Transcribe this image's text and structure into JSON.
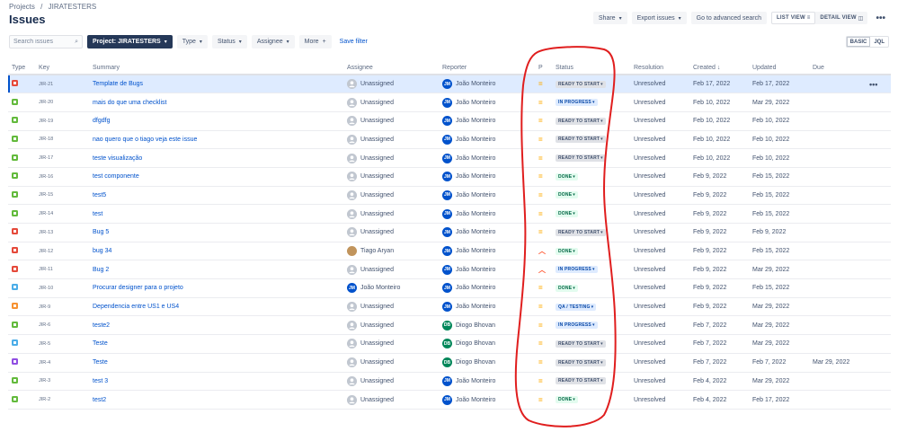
{
  "breadcrumb": [
    "Projects",
    "/",
    "JIRATESTERS"
  ],
  "page_title": "Issues",
  "toolbar": {
    "share": "Share",
    "export": "Export issues",
    "advanced": "Go to advanced search",
    "list_view": "LIST VIEW",
    "detail_view": "DETAIL VIEW",
    "more": "•••"
  },
  "filters": {
    "search_placeholder": "Search issues",
    "project": "Project: JIRATESTERS",
    "type": "Type",
    "status": "Status",
    "assignee": "Assignee",
    "more": "More",
    "save": "Save filter"
  },
  "mode": {
    "basic": "BASIC",
    "jql": "JQL"
  },
  "columns": [
    "Type",
    "Key",
    "Summary",
    "Assignee",
    "Reporter",
    "P",
    "Status",
    "Resolution",
    "Created",
    "Updated",
    "Due"
  ],
  "colors": {
    "bug": "#e5493a",
    "story": "#63ba3c",
    "task": "#4bade8",
    "subtask": "#4bade8",
    "epic": "#904ee2",
    "improvement": "#f79232",
    "medium_priority": "#ffab00",
    "high_priority": "#ff5630",
    "annotation": "#e01e1e"
  },
  "rows": [
    {
      "type": "bug",
      "key": "JIR-21",
      "summary": "Template de Bugs",
      "assignee": "Unassigned",
      "assignee_avatar": "unassigned",
      "reporter": "João Monteiro",
      "reporter_avatar": "JM",
      "priority": "medium",
      "status": "READY TO START",
      "status_kind": "todo",
      "resolution": "Unresolved",
      "created": "Feb 17, 2022",
      "updated": "Feb 17, 2022",
      "due": "",
      "selected": true
    },
    {
      "type": "story",
      "key": "JIR-20",
      "summary": "mais do que uma checklist",
      "assignee": "Unassigned",
      "assignee_avatar": "unassigned",
      "reporter": "João Monteiro",
      "reporter_avatar": "JM",
      "priority": "medium",
      "status": "IN PROGRESS",
      "status_kind": "progress",
      "resolution": "Unresolved",
      "created": "Feb 10, 2022",
      "updated": "Mar 29, 2022",
      "due": ""
    },
    {
      "type": "story",
      "key": "JIR-19",
      "summary": "dfgdfg",
      "assignee": "Unassigned",
      "assignee_avatar": "unassigned",
      "reporter": "João Monteiro",
      "reporter_avatar": "JM",
      "priority": "medium",
      "status": "READY TO START",
      "status_kind": "todo",
      "resolution": "Unresolved",
      "created": "Feb 10, 2022",
      "updated": "Feb 10, 2022",
      "due": ""
    },
    {
      "type": "story",
      "key": "JIR-18",
      "summary": "nao quero que o tiago veja este issue",
      "assignee": "Unassigned",
      "assignee_avatar": "unassigned",
      "reporter": "João Monteiro",
      "reporter_avatar": "JM",
      "priority": "medium",
      "status": "READY TO START",
      "status_kind": "todo",
      "resolution": "Unresolved",
      "created": "Feb 10, 2022",
      "updated": "Feb 10, 2022",
      "due": ""
    },
    {
      "type": "story",
      "key": "JIR-17",
      "summary": "teste visualização",
      "assignee": "Unassigned",
      "assignee_avatar": "unassigned",
      "reporter": "João Monteiro",
      "reporter_avatar": "JM",
      "priority": "medium",
      "status": "READY TO START",
      "status_kind": "todo",
      "resolution": "Unresolved",
      "created": "Feb 10, 2022",
      "updated": "Feb 10, 2022",
      "due": ""
    },
    {
      "type": "story",
      "key": "JIR-16",
      "summary": "test componente",
      "assignee": "Unassigned",
      "assignee_avatar": "unassigned",
      "reporter": "João Monteiro",
      "reporter_avatar": "JM",
      "priority": "medium",
      "status": "DONE",
      "status_kind": "done",
      "resolution": "Unresolved",
      "created": "Feb 9, 2022",
      "updated": "Feb 15, 2022",
      "due": ""
    },
    {
      "type": "story",
      "key": "JIR-15",
      "summary": "test5",
      "assignee": "Unassigned",
      "assignee_avatar": "unassigned",
      "reporter": "João Monteiro",
      "reporter_avatar": "JM",
      "priority": "medium",
      "status": "DONE",
      "status_kind": "done",
      "resolution": "Unresolved",
      "created": "Feb 9, 2022",
      "updated": "Feb 15, 2022",
      "due": ""
    },
    {
      "type": "story",
      "key": "JIR-14",
      "summary": "test",
      "assignee": "Unassigned",
      "assignee_avatar": "unassigned",
      "reporter": "João Monteiro",
      "reporter_avatar": "JM",
      "priority": "medium",
      "status": "DONE",
      "status_kind": "done",
      "resolution": "Unresolved",
      "created": "Feb 9, 2022",
      "updated": "Feb 15, 2022",
      "due": ""
    },
    {
      "type": "bug",
      "key": "JIR-13",
      "summary": "Bug 5",
      "assignee": "Unassigned",
      "assignee_avatar": "unassigned",
      "reporter": "João Monteiro",
      "reporter_avatar": "JM",
      "priority": "medium",
      "status": "READY TO START",
      "status_kind": "todo",
      "resolution": "Unresolved",
      "created": "Feb 9, 2022",
      "updated": "Feb 9, 2022",
      "due": ""
    },
    {
      "type": "bug",
      "key": "JIR-12",
      "summary": "bug 34",
      "assignee": "Tiago Aryan",
      "assignee_avatar": "TA",
      "reporter": "João Monteiro",
      "reporter_avatar": "JM",
      "priority": "high",
      "status": "DONE",
      "status_kind": "done",
      "resolution": "Unresolved",
      "created": "Feb 9, 2022",
      "updated": "Feb 15, 2022",
      "due": ""
    },
    {
      "type": "bug",
      "key": "JIR-11",
      "summary": "Bug 2",
      "assignee": "Unassigned",
      "assignee_avatar": "unassigned",
      "reporter": "João Monteiro",
      "reporter_avatar": "JM",
      "priority": "high",
      "status": "IN PROGRESS",
      "status_kind": "progress",
      "resolution": "Unresolved",
      "created": "Feb 9, 2022",
      "updated": "Mar 29, 2022",
      "due": ""
    },
    {
      "type": "task",
      "key": "JIR-10",
      "summary": "Procurar designer para o projeto",
      "assignee": "João Monteiro",
      "assignee_avatar": "JM",
      "reporter": "João Monteiro",
      "reporter_avatar": "JM",
      "priority": "medium",
      "status": "DONE",
      "status_kind": "done",
      "resolution": "Unresolved",
      "created": "Feb 9, 2022",
      "updated": "Feb 15, 2022",
      "due": ""
    },
    {
      "type": "improvement",
      "key": "JIR-9",
      "summary": "Dependencia entre US1 e US4",
      "assignee": "Unassigned",
      "assignee_avatar": "unassigned",
      "reporter": "João Monteiro",
      "reporter_avatar": "JM",
      "priority": "medium",
      "status": "QA / TESTING",
      "status_kind": "qa",
      "resolution": "Unresolved",
      "created": "Feb 9, 2022",
      "updated": "Mar 29, 2022",
      "due": ""
    },
    {
      "type": "story",
      "key": "JIR-6",
      "summary": "teste2",
      "assignee": "Unassigned",
      "assignee_avatar": "unassigned",
      "reporter": "Diogo Bhovan",
      "reporter_avatar": "DB",
      "priority": "medium",
      "status": "IN PROGRESS",
      "status_kind": "progress",
      "resolution": "Unresolved",
      "created": "Feb 7, 2022",
      "updated": "Mar 29, 2022",
      "due": ""
    },
    {
      "type": "subtask",
      "key": "JIR-5",
      "summary": "Teste",
      "assignee": "Unassigned",
      "assignee_avatar": "unassigned",
      "reporter": "Diogo Bhovan",
      "reporter_avatar": "DB",
      "priority": "medium",
      "status": "READY TO START",
      "status_kind": "todo",
      "resolution": "Unresolved",
      "created": "Feb 7, 2022",
      "updated": "Mar 29, 2022",
      "due": ""
    },
    {
      "type": "epic",
      "key": "JIR-4",
      "summary": "Teste",
      "assignee": "Unassigned",
      "assignee_avatar": "unassigned",
      "reporter": "Diogo Bhovan",
      "reporter_avatar": "DB",
      "priority": "medium",
      "status": "READY TO START",
      "status_kind": "todo",
      "resolution": "Unresolved",
      "created": "Feb 7, 2022",
      "updated": "Feb 7, 2022",
      "due": "Mar 29, 2022"
    },
    {
      "type": "story",
      "key": "JIR-3",
      "summary": "test 3",
      "assignee": "Unassigned",
      "assignee_avatar": "unassigned",
      "reporter": "João Monteiro",
      "reporter_avatar": "JM",
      "priority": "medium",
      "status": "READY TO START",
      "status_kind": "todo",
      "resolution": "Unresolved",
      "created": "Feb 4, 2022",
      "updated": "Mar 29, 2022",
      "due": ""
    },
    {
      "type": "story",
      "key": "JIR-2",
      "summary": "test2",
      "assignee": "Unassigned",
      "assignee_avatar": "unassigned",
      "reporter": "João Monteiro",
      "reporter_avatar": "JM",
      "priority": "medium",
      "status": "DONE",
      "status_kind": "done",
      "resolution": "Unresolved",
      "created": "Feb 4, 2022",
      "updated": "Feb 17, 2022",
      "due": ""
    }
  ]
}
